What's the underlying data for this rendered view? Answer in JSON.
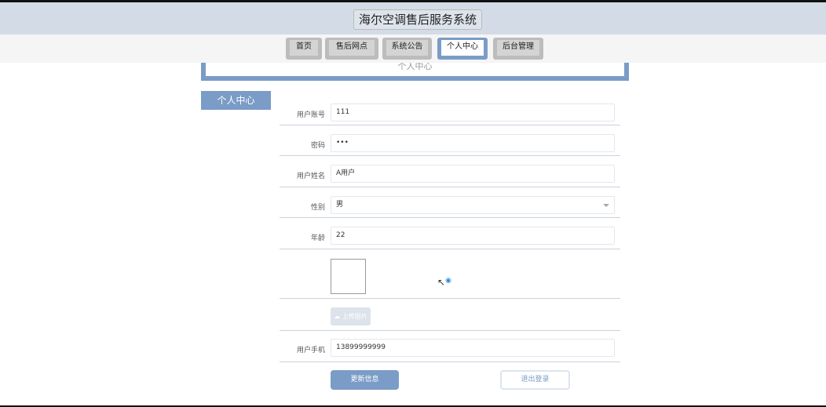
{
  "header": {
    "title": "海尔空调售后服务系统"
  },
  "nav": [
    {
      "label": "首页"
    },
    {
      "label": "售后网点"
    },
    {
      "label": "系统公告"
    },
    {
      "label": "个人中心"
    },
    {
      "label": "后台管理"
    }
  ],
  "panel": {
    "title": "个人中心"
  },
  "sidebar": {
    "item": "个人中心"
  },
  "form": {
    "account": {
      "label": "用户账号",
      "value": "111"
    },
    "password": {
      "label": "密码",
      "value": "•••"
    },
    "name": {
      "label": "用户姓名",
      "value": "A用户"
    },
    "gender": {
      "label": "性别",
      "value": "男"
    },
    "age": {
      "label": "年龄",
      "value": "22"
    },
    "upload": {
      "label": "上传图片"
    },
    "phone": {
      "label": "用户手机",
      "value": "13899999999"
    }
  },
  "buttons": {
    "update": "更新信息",
    "logout": "退出登录"
  },
  "colors": {
    "accent": "#7a9cc6",
    "header": "#d3dce6"
  }
}
